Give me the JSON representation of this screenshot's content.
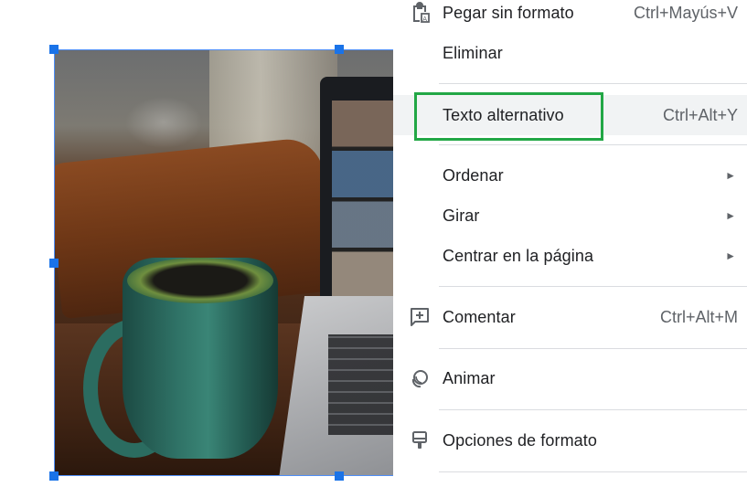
{
  "menu": {
    "items": [
      {
        "label": "Pegar sin formato",
        "shortcut": "Ctrl+Mayús+V",
        "icon": "clipboard-paste-icon"
      },
      {
        "label": "Eliminar",
        "shortcut": ""
      },
      {
        "label": "Texto alternativo",
        "shortcut": "Ctrl+Alt+Y"
      },
      {
        "label": "Ordenar",
        "submenu": true
      },
      {
        "label": "Girar",
        "submenu": true
      },
      {
        "label": "Centrar en la página",
        "submenu": true
      },
      {
        "label": "Comentar",
        "shortcut": "Ctrl+Alt+M",
        "icon": "add-comment-icon"
      },
      {
        "label": "Animar",
        "shortcut": "",
        "icon": "animate-icon"
      },
      {
        "label": "Opciones de formato",
        "shortcut": "",
        "icon": "format-paint-icon"
      }
    ],
    "submenu_glyph": "►",
    "highlighted_item": "Texto alternativo"
  },
  "colors": {
    "selection_handle": "#1a73e8",
    "highlight_border": "#22a745",
    "hover_background": "#f1f3f4"
  },
  "image": {
    "description_icon": "photo-coffee-mug-laptop"
  }
}
